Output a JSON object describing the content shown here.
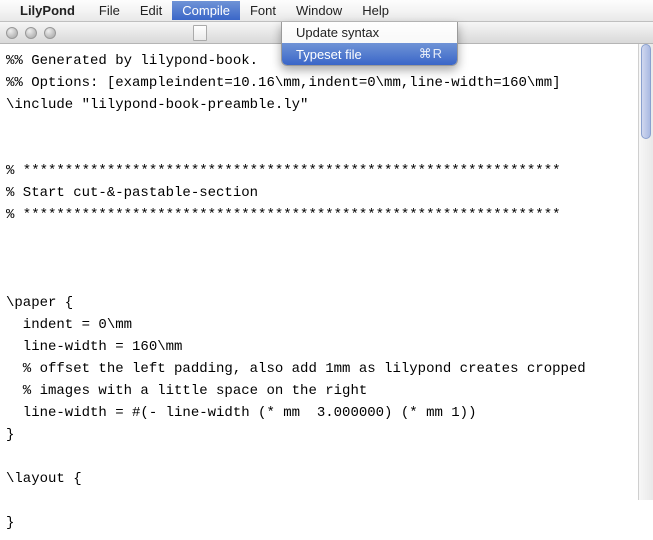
{
  "menubar": {
    "app_name": "LilyPond",
    "items": [
      "File",
      "Edit",
      "Compile",
      "Font",
      "Window",
      "Help"
    ],
    "open_index": 2
  },
  "dropdown": {
    "items": [
      {
        "label": "Update syntax",
        "shortcut": ""
      },
      {
        "label": "Typeset file",
        "shortcut": "⌘R"
      }
    ],
    "highlight_index": 1
  },
  "editor": {
    "lines": [
      "%% Generated by lilypond-book.",
      "%% Options: [exampleindent=10.16\\mm,indent=0\\mm,line-width=160\\mm]",
      "\\include \"lilypond-book-preamble.ly\"",
      "",
      "",
      "% ****************************************************************",
      "% Start cut-&-pastable-section",
      "% ****************************************************************",
      "",
      "",
      "",
      "\\paper {",
      "  indent = 0\\mm",
      "  line-width = 160\\mm",
      "  % offset the left padding, also add 1mm as lilypond creates cropped",
      "  % images with a little space on the right",
      "  line-width = #(- line-width (* mm  3.000000) (* mm 1))",
      "}",
      "",
      "\\layout {",
      "",
      "}"
    ]
  }
}
